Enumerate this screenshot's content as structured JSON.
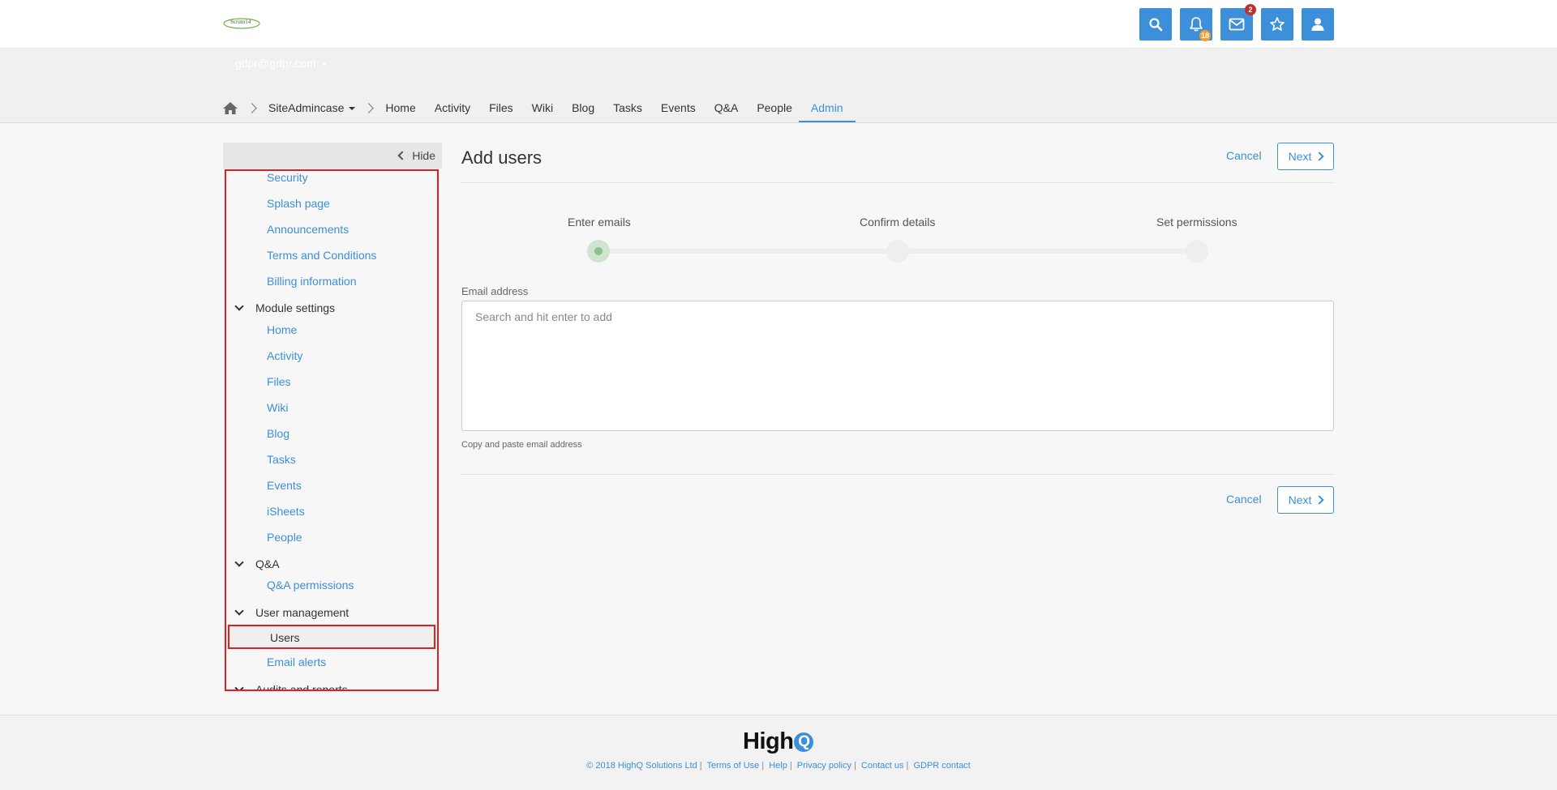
{
  "header": {
    "logo_text": "Scrum14",
    "notifications_badge": "18",
    "messages_badge": "2"
  },
  "subnav": {
    "user_email": "gdpr@gdpr.com",
    "site_name": "SiteAdmincase",
    "tabs": [
      "Home",
      "Activity",
      "Files",
      "Wiki",
      "Blog",
      "Tasks",
      "Events",
      "Q&A",
      "People"
    ],
    "active_tab": "Admin"
  },
  "sidebar": {
    "hide_label": "Hide",
    "site_links": [
      "Security",
      "Splash page",
      "Announcements",
      "Terms and Conditions",
      "Billing information"
    ],
    "module_settings_label": "Module settings",
    "module_links": [
      "Home",
      "Activity",
      "Files",
      "Wiki",
      "Blog",
      "Tasks",
      "Events",
      "iSheets",
      "People"
    ],
    "qa_label": "Q&A",
    "qa_links": [
      "Q&A permissions"
    ],
    "user_management_label": "User management",
    "selected_item": "Users",
    "user_links": [
      "Email alerts"
    ],
    "audits_label": "Audits and reports"
  },
  "main": {
    "title": "Add users",
    "cancel_label": "Cancel",
    "next_label": "Next",
    "steps": [
      "Enter emails",
      "Confirm details",
      "Set permissions"
    ],
    "email_label": "Email address",
    "email_placeholder": "Search and hit enter to add",
    "helper_text": "Copy and paste email address"
  },
  "footer": {
    "brand": "High",
    "brand_q": "Q",
    "links": [
      "© 2018 HighQ Solutions Ltd",
      "Terms of Use",
      "Help",
      "Privacy policy",
      "Contact us",
      "GDPR contact"
    ]
  },
  "colors": {
    "accent": "#3c8fd8",
    "highlight_border": "#e02020",
    "notification_badge": "#f0a030",
    "message_badge": "#c0302a"
  }
}
